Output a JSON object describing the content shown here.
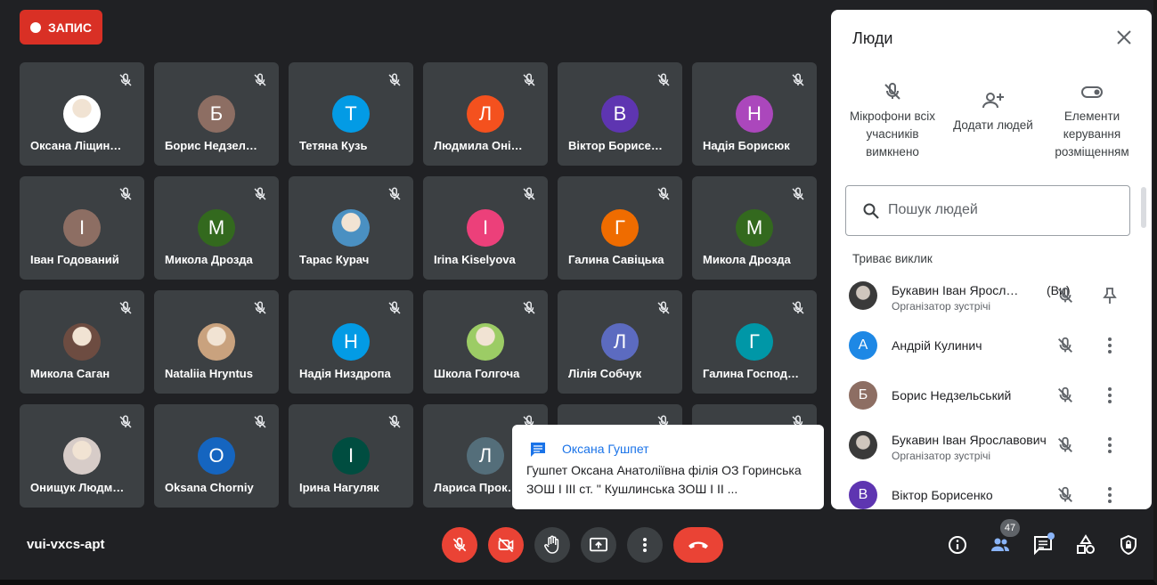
{
  "recording": {
    "label": "ЗАПИС"
  },
  "tiles": [
    {
      "name": "Оксана Ліщин…",
      "initial": "",
      "color": "#ffffff",
      "photo": true
    },
    {
      "name": "Борис Недзел…",
      "initial": "Б",
      "color": "#8d6e63"
    },
    {
      "name": "Тетяна Кузь",
      "initial": "Т",
      "color": "#039be5"
    },
    {
      "name": "Людмила Оні…",
      "initial": "Л",
      "color": "#f4511e"
    },
    {
      "name": "Віктор Борисе…",
      "initial": "В",
      "color": "#5e35b1"
    },
    {
      "name": "Надія Борисюк",
      "initial": "Н",
      "color": "#ab47bc"
    },
    {
      "name": "Іван Годований",
      "initial": "І",
      "color": "#8d6e63"
    },
    {
      "name": "Микола Дрозда",
      "initial": "М",
      "color": "#33691e"
    },
    {
      "name": "Тарас Курач",
      "initial": "",
      "color": "#4a90c2",
      "photo": true
    },
    {
      "name": "Irina Kiselyova",
      "initial": "І",
      "color": "#ec407a"
    },
    {
      "name": "Галина Савіцька",
      "initial": "Г",
      "color": "#ef6c00"
    },
    {
      "name": "Микола Дрозда",
      "initial": "М",
      "color": "#33691e"
    },
    {
      "name": "Микола Саган",
      "initial": "",
      "color": "#6d4c41",
      "photo": true
    },
    {
      "name": "Nataliia Hryntus",
      "initial": "",
      "color": "#c9a27e",
      "photo": true
    },
    {
      "name": "Надія Низдропа",
      "initial": "Н",
      "color": "#039be5"
    },
    {
      "name": "Школа Голгоча",
      "initial": "",
      "color": "#9ccc65",
      "photo": true
    },
    {
      "name": "Лілія Собчук",
      "initial": "Л",
      "color": "#5c6bc0"
    },
    {
      "name": "Галина Господ…",
      "initial": "Г",
      "color": "#0097a7"
    },
    {
      "name": "Онищук Людм…",
      "initial": "",
      "color": "#d7ccc8",
      "photo": true
    },
    {
      "name": "Oksana Chorniy",
      "initial": "O",
      "color": "#1565c0"
    },
    {
      "name": "Ірина Нагуляк",
      "initial": "І",
      "color": "#004d40"
    },
    {
      "name": "Лариса Прок…",
      "initial": "Л",
      "color": "#546e7a"
    },
    {
      "name": "",
      "initial": "",
      "color": "#3c4043",
      "empty": true
    },
    {
      "name": "",
      "initial": "",
      "color": "#3c4043",
      "empty": true
    }
  ],
  "panel": {
    "title": "Люди",
    "actions": [
      {
        "label": "Мікрофони всіх учасників вимкнено",
        "icon": "mic-off-icon"
      },
      {
        "label": "Додати людей",
        "icon": "person-add-icon"
      },
      {
        "label": "Елементи керування розміщенням",
        "icon": "toggle-icon"
      }
    ],
    "search_placeholder": "Пошук людей",
    "section": "Триває виклик",
    "people": [
      {
        "name": "Букавин Іван Яросл…",
        "you": "(Ви)",
        "sub": "Організатор зустрічі",
        "initial": "",
        "color": "#5f6368",
        "photo": true,
        "action": "pin-icon"
      },
      {
        "name": "Андрій Кулинич",
        "sub": "",
        "initial": "А",
        "color": "#1e88e5",
        "action": "more-icon"
      },
      {
        "name": "Борис Недзельський",
        "sub": "",
        "initial": "Б",
        "color": "#8d6e63",
        "action": "more-icon"
      },
      {
        "name": "Букавин Іван Ярославович",
        "sub": "Організатор зустрічі",
        "initial": "",
        "color": "#5f6368",
        "photo": true,
        "action": "more-icon"
      },
      {
        "name": "Віктор Борисенко",
        "sub": "",
        "initial": "В",
        "color": "#5e35b1",
        "action": "more-icon"
      }
    ]
  },
  "toast": {
    "sender": "Оксана Гушпет",
    "text": "Гушпет Оксана Анатоліївна філія ОЗ Горинська ЗОШ І ІІІ ст. \" Кушлинська ЗОШ І ІІ ..."
  },
  "meeting_code": "vui-vxcs-apt",
  "participants_count": "47",
  "colors": {
    "bg": "#202124",
    "tile": "#3c4043",
    "red": "#ea4335",
    "accent": "#1a73e8"
  }
}
